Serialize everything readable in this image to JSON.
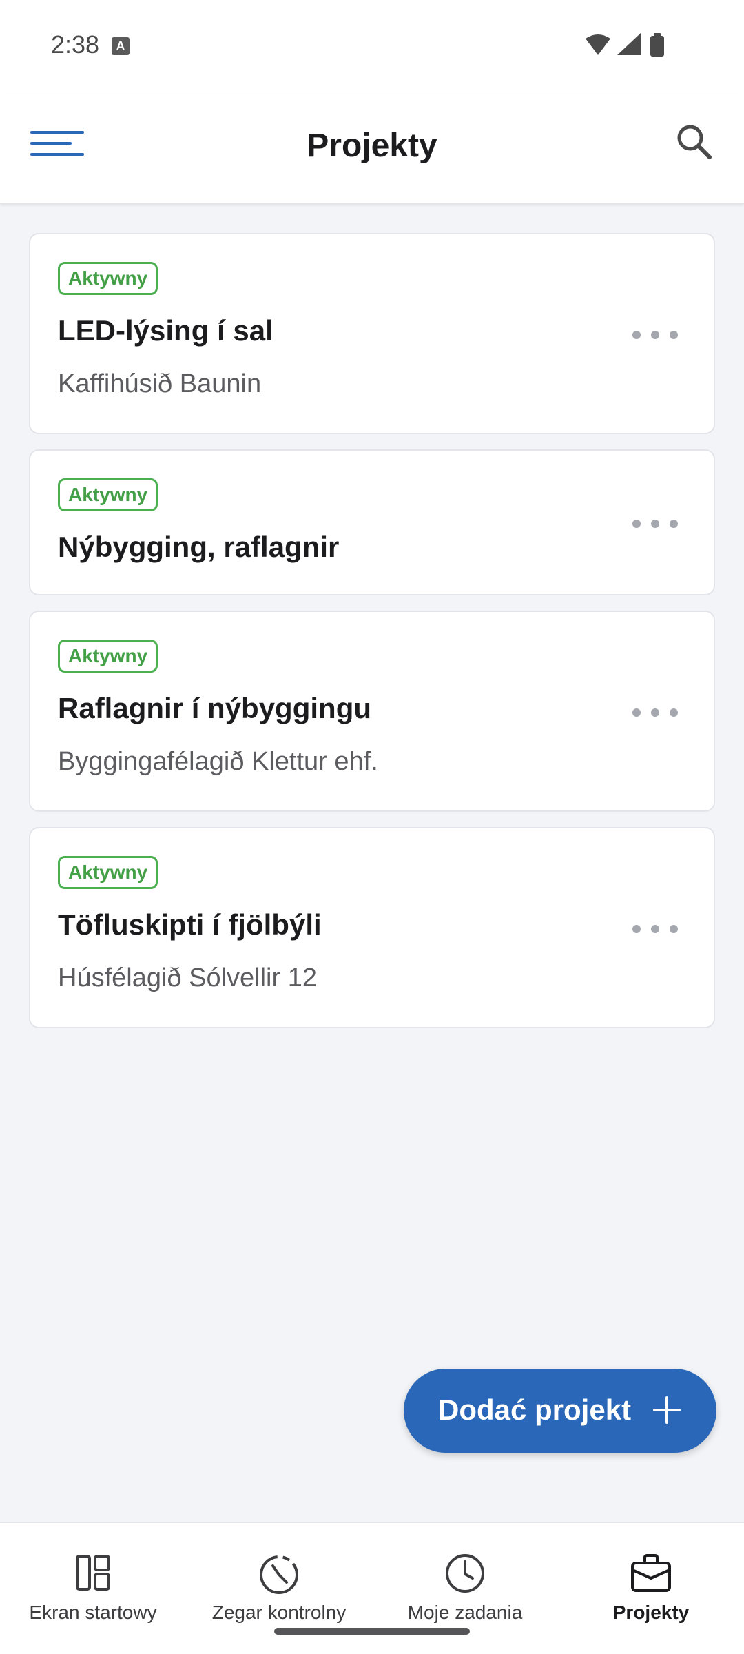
{
  "status_bar": {
    "time": "2:38",
    "notification_glyph": "A",
    "icons": [
      "wifi-icon",
      "signal-icon",
      "battery-icon"
    ]
  },
  "app_bar": {
    "title": "Projekty",
    "menu_icon": "hamburger-menu-icon",
    "search_icon": "search-icon",
    "accent_color": "#2a67b8"
  },
  "projects": [
    {
      "status": "Aktywny",
      "name": "LED-lýsing í sal",
      "client": "Kaffihúsið Baunin"
    },
    {
      "status": "Aktywny",
      "name": "Nýbygging, raflagnir",
      "client": ""
    },
    {
      "status": "Aktywny",
      "name": "Raflagnir í nýbyggingu",
      "client": "Byggingafélagið Klettur ehf."
    },
    {
      "status": "Aktywny",
      "name": "Töfluskipti í fjölbýli",
      "client": "Húsfélagið Sólvellir 12"
    }
  ],
  "status_color": "#4caf50",
  "fab": {
    "label": "Dodać projekt",
    "icon": "plus-icon",
    "color": "#2a67b8"
  },
  "bottom_nav": {
    "items": [
      {
        "label": "Ekran startowy",
        "icon": "dashboard-icon",
        "active": false
      },
      {
        "label": "Zegar kontrolny",
        "icon": "timer-icon",
        "active": false
      },
      {
        "label": "Moje zadania",
        "icon": "clock-icon",
        "active": false
      },
      {
        "label": "Projekty",
        "icon": "briefcase-icon",
        "active": true
      }
    ]
  }
}
